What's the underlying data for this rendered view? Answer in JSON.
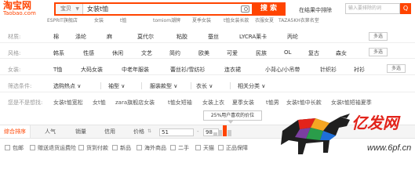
{
  "logo": {
    "name": "淘宝网",
    "domain": "Taobao.com"
  },
  "search": {
    "scope": "宝贝",
    "query": "女装t恤",
    "button": "搜 索"
  },
  "inresult": {
    "label": "在结果中排除",
    "placeholder": "输入要排除的词",
    "button": "Q"
  },
  "hotbar": [
    "ESPRIT旗舰店",
    "女装",
    "t恤",
    "tomiom潮牌",
    "夏季女装",
    "t恤女装长款",
    "衣服女夏",
    "TAZA5KH衣第名堂"
  ],
  "rows": {
    "material": {
      "label": "材质:",
      "values": [
        "棉",
        "涤纶",
        "麻",
        "莫代尔",
        "粘胶",
        "蚕丝",
        "LYCRA莱卡",
        "丙纶"
      ],
      "more": "多选"
    },
    "style": {
      "label": "风格:",
      "values": [
        "韩系",
        "性感",
        "休闲",
        "文艺",
        "简约",
        "欧美",
        "可爱",
        "民族",
        "OL",
        "复古",
        "森女"
      ],
      "more": "多选"
    },
    "women": {
      "label": "女装:",
      "values": [
        "T恤",
        "大码女装",
        "中老年服装",
        "蕾丝衫/雪纺衫",
        "连衣裙",
        "小背心/小吊带",
        "针织衫",
        "衬衫"
      ],
      "more": "多选"
    },
    "filter": {
      "label": "筛选条件:",
      "values": [
        "选购热点 ∨",
        "袖型 ∨",
        "服装款型 ∨",
        "衣长 ∨",
        "相关分类 ∨"
      ]
    },
    "related": {
      "label": "您是不是想找:",
      "values": [
        "女装t恤宽松",
        "女t恤",
        "zara旗舰店女装",
        "t恤女短袖",
        "女装上衣",
        "夏季女装",
        "t恤男",
        "女装t恤中长款",
        "女装t恤短袖夏季"
      ]
    }
  },
  "sort": {
    "items": [
      "综合排序",
      "人气",
      "销量",
      "信用",
      "价格"
    ],
    "price_from": "51",
    "price_to": "98",
    "tooltip": "25%用户喜欢的价位"
  },
  "checks": [
    "包邮",
    "赠送退货运费险",
    "货到付款",
    "新品",
    "海外商品",
    "二手",
    "天猫",
    "正品保障"
  ],
  "watermark": {
    "brand": "亿发网",
    "site": "www.6pf.cn"
  },
  "price_dist": [
    0.35,
    0.55,
    1.0,
    0.6
  ],
  "colors": {
    "accent": "#ff4400",
    "brand_red": "#e2231a"
  }
}
